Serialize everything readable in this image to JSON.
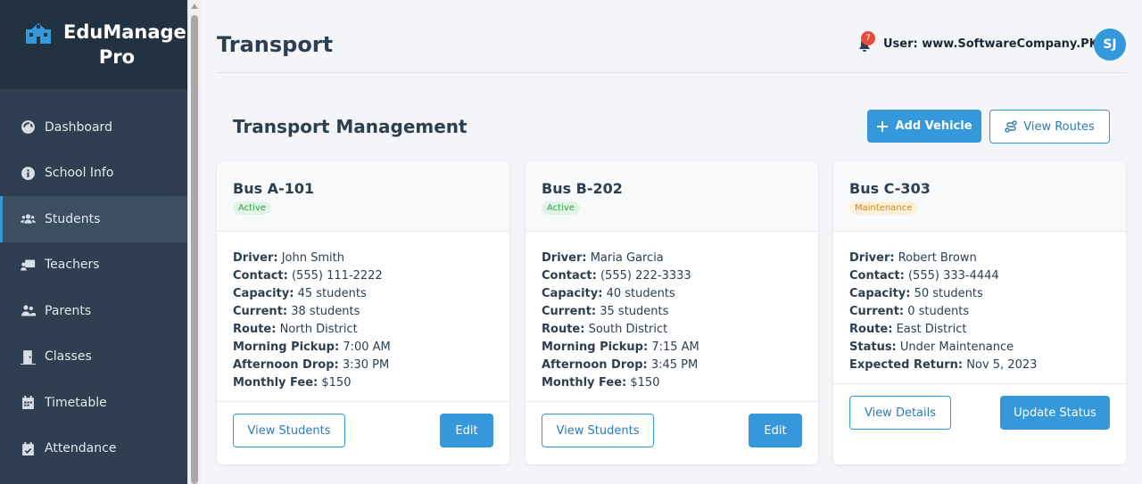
{
  "app": {
    "name": "EduManage Pro"
  },
  "sidebar": {
    "items": [
      {
        "label": "Dashboard",
        "icon": "dashboard-icon",
        "active": false
      },
      {
        "label": "School Info",
        "icon": "info-icon",
        "active": false
      },
      {
        "label": "Students",
        "icon": "users-icon",
        "active": true
      },
      {
        "label": "Teachers",
        "icon": "teacher-icon",
        "active": false
      },
      {
        "label": "Parents",
        "icon": "parents-icon",
        "active": false
      },
      {
        "label": "Classes",
        "icon": "door-icon",
        "active": false
      },
      {
        "label": "Timetable",
        "icon": "calendar-icon",
        "active": false
      },
      {
        "label": "Attendance",
        "icon": "calendar-check-icon",
        "active": false
      }
    ]
  },
  "header": {
    "title": "Transport",
    "notification_count": "7",
    "user_label": "User: www.SoftwareCompany.PK",
    "avatar_initials": "SJ"
  },
  "section": {
    "title": "Transport Management",
    "add_vehicle_label": "Add Vehicle",
    "view_routes_label": "View Routes"
  },
  "vehicles": [
    {
      "name": "Bus A-101",
      "status": "Active",
      "fields": [
        {
          "label": "Driver:",
          "value": "John Smith"
        },
        {
          "label": "Contact:",
          "value": "(555) 111-2222"
        },
        {
          "label": "Capacity:",
          "value": "45 students"
        },
        {
          "label": "Current:",
          "value": "38 students"
        },
        {
          "label": "Route:",
          "value": "North District"
        },
        {
          "label": "Morning Pickup:",
          "value": "7:00 AM"
        },
        {
          "label": "Afternoon Drop:",
          "value": "3:30 PM"
        },
        {
          "label": "Monthly Fee:",
          "value": "$150"
        }
      ],
      "secondary_action": "View Students",
      "primary_action": "Edit"
    },
    {
      "name": "Bus B-202",
      "status": "Active",
      "fields": [
        {
          "label": "Driver:",
          "value": "Maria Garcia"
        },
        {
          "label": "Contact:",
          "value": "(555) 222-3333"
        },
        {
          "label": "Capacity:",
          "value": "40 students"
        },
        {
          "label": "Current:",
          "value": "35 students"
        },
        {
          "label": "Route:",
          "value": "South District"
        },
        {
          "label": "Morning Pickup:",
          "value": "7:15 AM"
        },
        {
          "label": "Afternoon Drop:",
          "value": "3:45 PM"
        },
        {
          "label": "Monthly Fee:",
          "value": "$150"
        }
      ],
      "secondary_action": "View Students",
      "primary_action": "Edit"
    },
    {
      "name": "Bus C-303",
      "status": "Maintenance",
      "fields": [
        {
          "label": "Driver:",
          "value": "Robert Brown"
        },
        {
          "label": "Contact:",
          "value": "(555) 333-4444"
        },
        {
          "label": "Capacity:",
          "value": "50 students"
        },
        {
          "label": "Current:",
          "value": "0 students"
        },
        {
          "label": "Route:",
          "value": "East District"
        },
        {
          "label": "Status:",
          "value": "Under Maintenance"
        },
        {
          "label": "Expected Return:",
          "value": "Nov 5, 2023"
        }
      ],
      "secondary_action": "View Details",
      "primary_action": "Update Status"
    }
  ],
  "colors": {
    "accent": "#3498db",
    "sidebar": "#2f3e50",
    "danger": "#e74c3c"
  }
}
